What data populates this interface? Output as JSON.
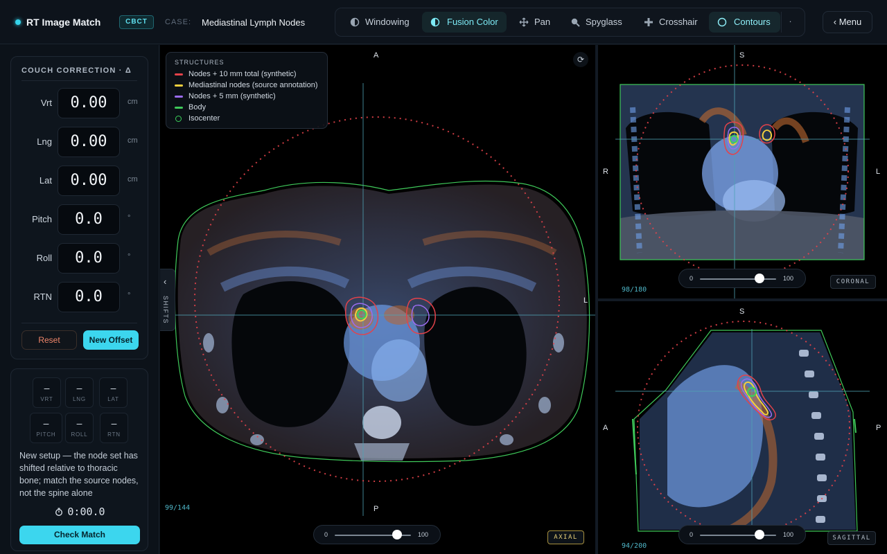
{
  "header": {
    "app_title": "RT Image Match",
    "modality": "CBCT",
    "case_label": "CASE:",
    "case_name": "Mediastinal Lymph Nodes",
    "menu_label": "‹ Menu"
  },
  "toolbar": {
    "tools": [
      {
        "label": "Windowing",
        "icon": "half-circle-icon",
        "state": "normal"
      },
      {
        "label": "Fusion Color",
        "icon": "half-circle-icon",
        "state": "active"
      },
      {
        "label": "Pan",
        "icon": "move-icon",
        "state": "normal"
      },
      {
        "label": "Spyglass",
        "icon": "magnifier-icon",
        "state": "normal"
      },
      {
        "label": "Crosshair",
        "icon": "crosshair-icon",
        "state": "normal"
      },
      {
        "label": "Contours",
        "icon": "circle-icon",
        "state": "active"
      }
    ],
    "more_label": "·"
  },
  "couch": {
    "title": "COUCH CORRECTION · Δ",
    "fields": [
      {
        "label": "Vrt",
        "value": "0.00",
        "unit": "cm"
      },
      {
        "label": "Lng",
        "value": "0.00",
        "unit": "cm"
      },
      {
        "label": "Lat",
        "value": "0.00",
        "unit": "cm"
      },
      {
        "label": "Pitch",
        "value": "0.0",
        "unit": "°"
      },
      {
        "label": "Roll",
        "value": "0.0",
        "unit": "°"
      },
      {
        "label": "RTN",
        "value": "0.0",
        "unit": "°"
      }
    ],
    "reset_label": "Reset",
    "new_offset_label": "New Offset"
  },
  "shifts": {
    "stats": [
      {
        "value": "–",
        "label": "VRT"
      },
      {
        "value": "–",
        "label": "LNG"
      },
      {
        "value": "–",
        "label": "LAT"
      },
      {
        "value": "–",
        "label": "PITCH"
      },
      {
        "value": "–",
        "label": "ROLL"
      },
      {
        "value": "–",
        "label": "RTN"
      }
    ],
    "hint": "New setup — the node set has shifted relative to thoracic bone; match the source nodes, not the spine alone",
    "timer": "0:00.0",
    "check_label": "Check Match"
  },
  "legend": {
    "title": "STRUCTURES",
    "items": [
      {
        "label": "Nodes + 10 mm total (synthetic)",
        "color": "#e4424a",
        "shape": "line"
      },
      {
        "label": "Mediastinal nodes (source annotation)",
        "color": "#f3d03e",
        "shape": "line"
      },
      {
        "label": "Nodes + 5 mm (synthetic)",
        "color": "#9b6cf0",
        "shape": "line"
      },
      {
        "label": "Body",
        "color": "#3fc95a",
        "shape": "line"
      },
      {
        "label": "Isocenter",
        "color": "#3bd25b",
        "shape": "circle"
      }
    ]
  },
  "axial": {
    "top": "A",
    "bottom": "P",
    "right": "L",
    "slice": "99/144",
    "badge": "AXIAL",
    "slider": {
      "min": "0",
      "max": "100",
      "value": 82
    },
    "side_tab": "SHIFTS"
  },
  "coronal": {
    "top": "S",
    "left": "R",
    "right": "L",
    "slice": "98/180",
    "badge": "CORONAL",
    "slider": {
      "min": "0",
      "max": "100",
      "value": 78
    }
  },
  "sagittal": {
    "top": "S",
    "left": "A",
    "right": "P",
    "slice": "94/200",
    "badge": "SAGITTAL",
    "slider": {
      "min": "0",
      "max": "100",
      "value": 78
    }
  },
  "colors": {
    "accent": "#3cd6ee",
    "ptv10": "#e4424a",
    "nodes": "#f3d03e",
    "ptv5": "#9b6cf0",
    "body": "#3fc95a",
    "crosshair": "#4fa3b5"
  }
}
